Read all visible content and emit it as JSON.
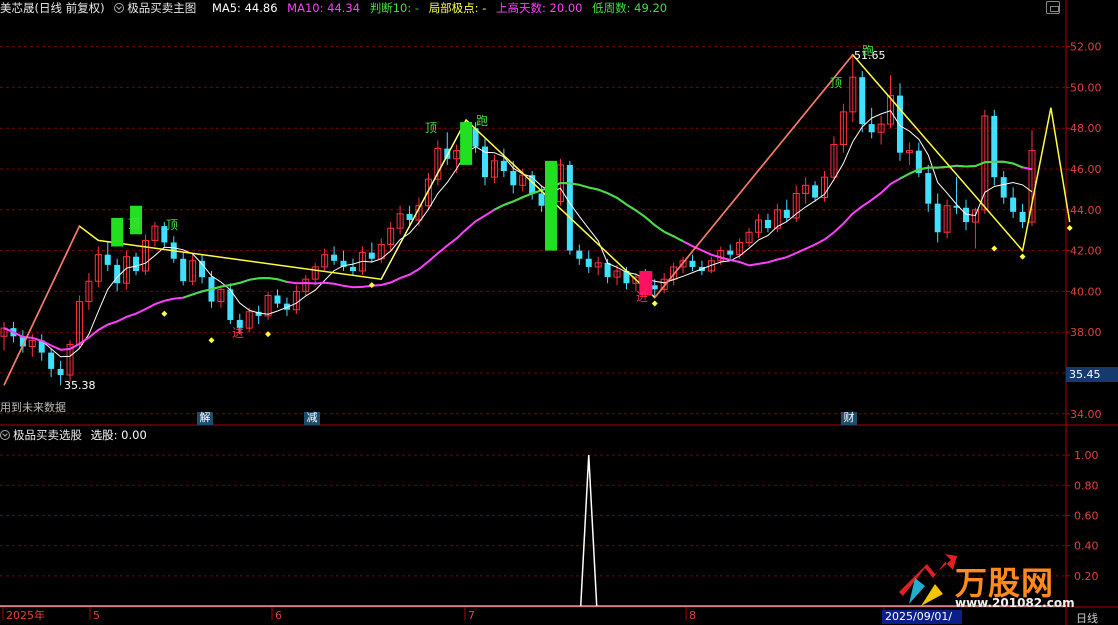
{
  "header": {
    "stock": "美芯晟(日线 前复权)",
    "indicator": "极品买卖主图",
    "ma5": "MA5: 44.86",
    "ma10": "MA10: 44.34",
    "judge": "判断10: -",
    "local": "局部极点: -",
    "up_days": "上高天数: 20.00",
    "low_week": "低周数: 49.20"
  },
  "sub_header": {
    "indicator": "极品买卖选股",
    "value": "选股: 0.00"
  },
  "notes": {
    "future_data": "用到未来数据",
    "period": "日线",
    "current_date": "2025/09/01/一",
    "last_price": "35.45",
    "high_label": "51.65",
    "low_label": "35.38"
  },
  "signals": {
    "top": "顶",
    "run": "跑",
    "enter": "进"
  },
  "events": [
    "解",
    "减",
    "财"
  ],
  "watermark": {
    "brand": "万股网",
    "url": "www.201082.com"
  },
  "colors": {
    "up": "#ff3040",
    "down": "#40e0ff",
    "ma_short": "#ffffff",
    "ma_long": "#ff40ff",
    "zigzag": "#ffff40",
    "trend_up": "#ff7070",
    "trend_down": "#40e040",
    "signal_green": "#20e020",
    "signal_pink": "#ff1060",
    "grid": "#7a0000"
  },
  "chart_data": [
    {
      "type": "candlestick",
      "title": "极品买卖主图",
      "ylim": [
        33.5,
        53.5
      ],
      "y_ticks": [
        34.0,
        36.0,
        38.0,
        40.0,
        42.0,
        44.0,
        46.0,
        48.0,
        50.0,
        52.0
      ],
      "x_ticks": [
        "2025年",
        "5",
        "6",
        "7",
        "8",
        "9"
      ],
      "series": [
        {
          "name": "K",
          "ohlc": [
            [
              37.8,
              38.5,
              37.1,
              38.2
            ],
            [
              38.2,
              38.5,
              37.5,
              37.8
            ],
            [
              37.8,
              38.1,
              37.0,
              37.3
            ],
            [
              37.3,
              37.9,
              36.8,
              37.6
            ],
            [
              37.6,
              37.9,
              36.6,
              37.0
            ],
            [
              37.0,
              37.2,
              35.8,
              36.2
            ],
            [
              36.2,
              36.6,
              35.4,
              35.9
            ],
            [
              35.9,
              37.6,
              35.6,
              37.4
            ],
            [
              37.4,
              39.8,
              37.2,
              39.5
            ],
            [
              39.5,
              40.9,
              39.1,
              40.5
            ],
            [
              40.5,
              42.2,
              40.2,
              41.8
            ],
            [
              41.8,
              42.4,
              41.0,
              41.3
            ],
            [
              41.3,
              41.6,
              40.0,
              40.4
            ],
            [
              40.4,
              42.0,
              40.1,
              41.7
            ],
            [
              41.7,
              41.9,
              40.8,
              41.0
            ],
            [
              41.0,
              42.8,
              40.8,
              42.5
            ],
            [
              42.5,
              43.4,
              42.2,
              43.2
            ],
            [
              43.2,
              43.4,
              42.2,
              42.4
            ],
            [
              42.4,
              42.7,
              41.4,
              41.6
            ],
            [
              41.6,
              41.9,
              40.3,
              40.5
            ],
            [
              40.5,
              41.8,
              40.3,
              41.5
            ],
            [
              41.5,
              41.8,
              40.4,
              40.7
            ],
            [
              40.7,
              41.0,
              39.2,
              39.5
            ],
            [
              39.5,
              40.3,
              39.2,
              40.1
            ],
            [
              40.1,
              40.4,
              38.4,
              38.6
            ],
            [
              38.6,
              38.9,
              37.9,
              38.2
            ],
            [
              38.2,
              39.2,
              38.0,
              39.0
            ],
            [
              39.0,
              39.3,
              38.4,
              38.8
            ],
            [
              38.8,
              40.0,
              38.6,
              39.8
            ],
            [
              39.8,
              40.1,
              39.2,
              39.4
            ],
            [
              39.4,
              39.7,
              38.8,
              39.1
            ],
            [
              39.1,
              40.3,
              38.9,
              40.0
            ],
            [
              40.0,
              40.8,
              39.8,
              40.6
            ],
            [
              40.6,
              41.4,
              40.3,
              41.2
            ],
            [
              41.2,
              42.1,
              41.0,
              41.8
            ],
            [
              41.8,
              42.2,
              41.3,
              41.5
            ],
            [
              41.5,
              42.0,
              41.0,
              41.2
            ],
            [
              41.2,
              41.6,
              40.8,
              41.0
            ],
            [
              41.0,
              42.2,
              40.8,
              41.9
            ],
            [
              41.9,
              42.4,
              41.4,
              41.6
            ],
            [
              41.6,
              42.6,
              41.4,
              42.3
            ],
            [
              42.3,
              43.4,
              42.0,
              43.1
            ],
            [
              43.1,
              44.2,
              42.8,
              43.8
            ],
            [
              43.8,
              44.2,
              43.2,
              43.5
            ],
            [
              43.5,
              44.6,
              43.2,
              44.2
            ],
            [
              44.2,
              45.8,
              44.0,
              45.5
            ],
            [
              45.5,
              47.4,
              45.2,
              47.0
            ],
            [
              47.0,
              47.8,
              46.2,
              46.5
            ],
            [
              46.5,
              47.2,
              45.8,
              46.9
            ],
            [
              46.9,
              48.4,
              46.6,
              48.0
            ],
            [
              48.0,
              48.3,
              46.8,
              47.1
            ],
            [
              47.1,
              47.5,
              45.2,
              45.6
            ],
            [
              45.6,
              46.7,
              45.3,
              46.4
            ],
            [
              46.4,
              47.0,
              45.6,
              45.9
            ],
            [
              45.9,
              46.4,
              44.8,
              45.2
            ],
            [
              45.2,
              46.0,
              44.9,
              45.7
            ],
            [
              45.7,
              45.9,
              44.5,
              44.8
            ],
            [
              44.8,
              45.2,
              43.9,
              44.2
            ],
            [
              44.2,
              44.6,
              43.8,
              44.4
            ],
            [
              44.4,
              46.5,
              44.2,
              46.2
            ],
            [
              46.2,
              46.4,
              41.8,
              42.0
            ],
            [
              42.0,
              42.3,
              41.3,
              41.6
            ],
            [
              41.6,
              42.0,
              40.9,
              41.2
            ],
            [
              41.2,
              41.7,
              40.8,
              41.4
            ],
            [
              41.4,
              41.6,
              40.4,
              40.7
            ],
            [
              40.7,
              41.3,
              40.3,
              41.0
            ],
            [
              41.0,
              41.2,
              40.1,
              40.4
            ],
            [
              40.4,
              40.9,
              40.0,
              40.7
            ],
            [
              40.7,
              41.1,
              40.0,
              40.3
            ],
            [
              40.3,
              40.6,
              39.7,
              40.1
            ],
            [
              40.1,
              40.9,
              39.9,
              40.6
            ],
            [
              40.6,
              41.4,
              40.3,
              41.2
            ],
            [
              41.2,
              41.7,
              40.9,
              41.5
            ],
            [
              41.5,
              41.8,
              41.0,
              41.2
            ],
            [
              41.2,
              41.5,
              40.8,
              41.0
            ],
            [
              41.0,
              41.7,
              40.9,
              41.5
            ],
            [
              41.5,
              42.2,
              41.3,
              42.0
            ],
            [
              42.0,
              42.3,
              41.6,
              41.8
            ],
            [
              41.8,
              42.6,
              41.6,
              42.4
            ],
            [
              42.4,
              43.1,
              42.2,
              42.9
            ],
            [
              42.9,
              43.8,
              42.6,
              43.5
            ],
            [
              43.5,
              43.8,
              42.9,
              43.1
            ],
            [
              43.1,
              44.3,
              42.9,
              44.0
            ],
            [
              44.0,
              44.5,
              43.4,
              43.6
            ],
            [
              43.6,
              45.2,
              43.4,
              44.8
            ],
            [
              44.8,
              45.6,
              44.3,
              45.2
            ],
            [
              45.2,
              45.4,
              44.4,
              44.6
            ],
            [
              44.6,
              45.9,
              44.4,
              45.6
            ],
            [
              45.6,
              47.6,
              45.4,
              47.2
            ],
            [
              47.2,
              49.2,
              46.8,
              48.8
            ],
            [
              48.8,
              51.6,
              48.3,
              50.5
            ],
            [
              50.5,
              50.8,
              47.8,
              48.2
            ],
            [
              48.2,
              49.0,
              47.5,
              47.8
            ],
            [
              47.8,
              48.6,
              47.2,
              48.2
            ],
            [
              48.2,
              50.6,
              48.0,
              49.6
            ],
            [
              49.6,
              50.2,
              46.4,
              46.8
            ],
            [
              46.8,
              47.3,
              46.2,
              46.9
            ],
            [
              46.9,
              47.3,
              45.6,
              45.8
            ],
            [
              45.8,
              46.2,
              43.9,
              44.3
            ],
            [
              44.3,
              44.8,
              42.4,
              42.9
            ],
            [
              42.9,
              44.5,
              42.6,
              44.2
            ],
            [
              44.2,
              45.6,
              43.8,
              44.1
            ],
            [
              44.1,
              44.5,
              43.0,
              43.4
            ],
            [
              43.4,
              44.1,
              42.1,
              44.0
            ],
            [
              44.0,
              48.9,
              43.8,
              48.6
            ],
            [
              48.6,
              48.9,
              45.2,
              45.6
            ],
            [
              45.6,
              45.9,
              44.3,
              44.6
            ],
            [
              44.6,
              45.1,
              43.6,
              43.9
            ],
            [
              43.9,
              44.3,
              43.1,
              43.4
            ],
            [
              43.4,
              47.9,
              43.2,
              46.9
            ]
          ]
        },
        {
          "name": "MA5"
        },
        {
          "name": "MA10"
        },
        {
          "name": "zigzag"
        }
      ]
    },
    {
      "type": "line",
      "title": "极品买卖选股",
      "ylim": [
        0,
        1.1
      ],
      "y_ticks": [
        0.2,
        0.4,
        0.6,
        0.8,
        1.0
      ],
      "series": [
        {
          "name": "选股",
          "spike_index": 62,
          "values_note_zero_elsewhere": 0
        }
      ]
    }
  ]
}
